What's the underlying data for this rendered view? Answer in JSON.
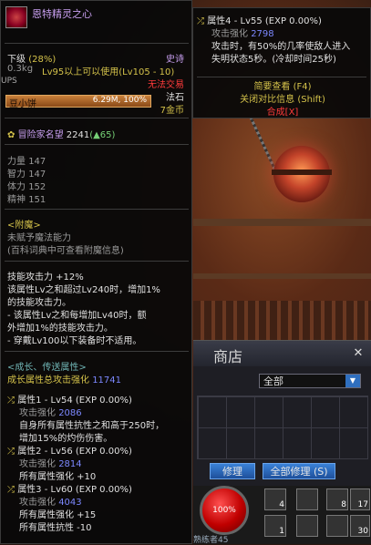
{
  "tooltip": {
    "item_name": "恩特精灵之心",
    "grade": "下级",
    "grade_pct": "(28%)",
    "rarity": "史诗",
    "weight": "0.3kg",
    "level_req": "Lv95以上可以使用(Lv105 - 10)",
    "trade_status": "无法交易",
    "ups_partial": "UPS",
    "type_partial": "法石",
    "price_partial": "7金币",
    "owner": {
      "name": "豆小饼",
      "value": "6.29M, 100%"
    },
    "adventure": {
      "label": "冒险家名望",
      "value": "2241",
      "delta": "(▲65)"
    },
    "stats": [
      {
        "name": "力量",
        "value": "147"
      },
      {
        "name": "智力",
        "value": "147"
      },
      {
        "name": "体力",
        "value": "152"
      },
      {
        "name": "精神",
        "value": "151"
      }
    ],
    "enchant": {
      "title": "<附魔>",
      "line1": "未赋予魔法能力",
      "line2": "(百科词典中可查看附魔信息)"
    },
    "skill_section": [
      "技能攻击力 +12%",
      "该属性Lv之和超过Lv240时，增加1%",
      "的技能攻击力。",
      "- 该属性Lv之和每增加Lv40时，额",
      "外增加1%的技能攻击力。",
      "- 穿戴Lv100以下装备时不适用。"
    ],
    "growth": {
      "title": "<成长、传送属性>",
      "total_label": "成长属性总攻击强化",
      "total_value": "11741",
      "attrs": [
        {
          "head": "属性1 - Lv54 (EXP 0.00%)",
          "atk_label": "攻击强化",
          "atk_value": "2086",
          "lines": [
            "自身所有属性抗性之和高于250时，",
            "增加15%的灼伤伤害。"
          ]
        },
        {
          "head": "属性2 - Lv56 (EXP 0.00%)",
          "atk_label": "攻击强化",
          "atk_value": "2814",
          "lines": [
            "所有属性强化 +10"
          ]
        },
        {
          "head": "属性3 - Lv60 (EXP 0.00%)",
          "atk_label": "攻击强化",
          "atk_value": "4043",
          "lines": [
            "所有属性强化 +15",
            "所有属性抗性 -10"
          ]
        }
      ]
    }
  },
  "side_tooltip": {
    "head": "属性4 - Lv55 (EXP 0.00%)",
    "atk_label": "攻击强化",
    "atk_value": "2798",
    "lines": [
      "攻击时，有50%的几率使敌人进入",
      "失明状态5秒。(冷却时间25秒)"
    ],
    "brief_view": "简要查看 (F4)",
    "close_compare": "关闭对比信息 (Shift)",
    "combine": "合成[X]"
  },
  "shop": {
    "title_partial": "商店",
    "filter": "全部",
    "repair": "修理",
    "repair_all": "全部修理 (S)"
  },
  "hud": {
    "hp": "100%",
    "skill_counts": [
      "4",
      "8",
      "17",
      "1",
      "30"
    ],
    "level_partial": "熟练者45"
  }
}
